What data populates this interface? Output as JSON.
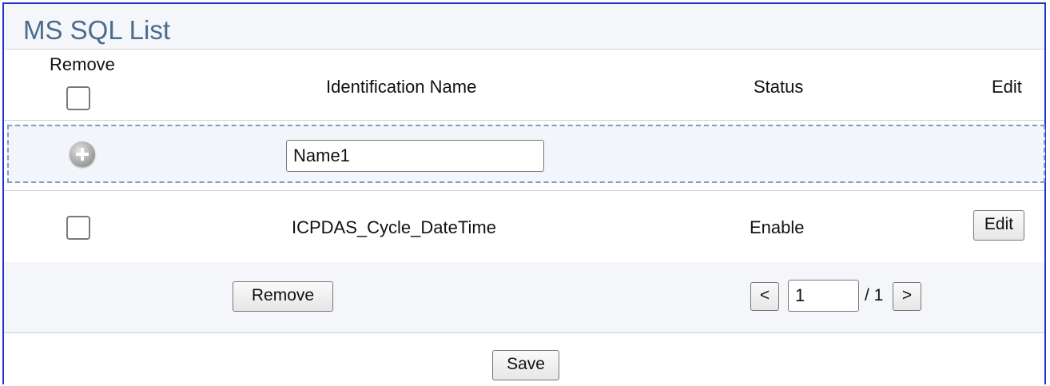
{
  "panel": {
    "title": "MS SQL List"
  },
  "table": {
    "headers": {
      "remove": "Remove",
      "identification_name": "Identification Name",
      "status": "Status",
      "edit": "Edit"
    },
    "new_entry": {
      "name_value": "Name1"
    },
    "rows": [
      {
        "name": "ICPDAS_Cycle_DateTime",
        "status": "Enable",
        "edit_label": "Edit",
        "checked": false
      }
    ]
  },
  "controls": {
    "remove_label": "Remove",
    "prev_label": "<",
    "page_value": "1",
    "page_total": "/ 1",
    "next_label": ">"
  },
  "footer": {
    "save_label": "Save"
  }
}
